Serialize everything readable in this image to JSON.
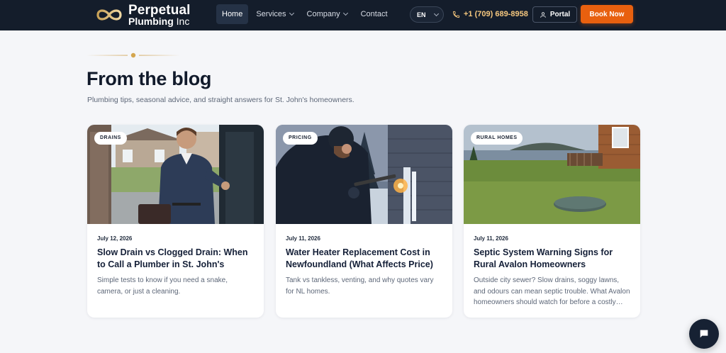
{
  "header": {
    "brand_line1": "Perpetual",
    "brand_line2": "Plumbing",
    "brand_suffix": "Inc",
    "nav": [
      {
        "label": "Home",
        "active": true
      },
      {
        "label": "Services",
        "dropdown": true
      },
      {
        "label": "Company",
        "dropdown": true
      },
      {
        "label": "Contact"
      }
    ],
    "language": "EN",
    "phone": "+1 (709) 689-8958",
    "portal_label": "Portal",
    "book_label": "Book Now"
  },
  "blog": {
    "heading": "From the blog",
    "subheading": "Plumbing tips, seasonal advice, and straight answers for St. John's homeowners.",
    "posts": [
      {
        "tag": "DRAINS",
        "date": "July 12, 2026",
        "title": "Slow Drain vs Clogged Drain: When to Call a Plumber in St. John's",
        "excerpt": "Simple tests to know if you need a snake, camera, or just a cleaning."
      },
      {
        "tag": "PRICING",
        "date": "July 11, 2026",
        "title": "Water Heater Replacement Cost in Newfoundland (What Affects Price)",
        "excerpt": "Tank vs tankless, venting, and why quotes vary for NL homes."
      },
      {
        "tag": "RURAL HOMES",
        "date": "July 11, 2026",
        "title": "Septic System Warning Signs for Rural Avalon Homeowners",
        "excerpt": "Outside city sewer? Slow drains, soggy lawns, and odours can mean septic trouble. What Avalon homeowners should watch for before a costly…"
      }
    ]
  },
  "colors": {
    "nav_bg": "#141d2b",
    "accent": "#e8600f",
    "phone": "#f5c77e",
    "heading": "#111a2b"
  }
}
